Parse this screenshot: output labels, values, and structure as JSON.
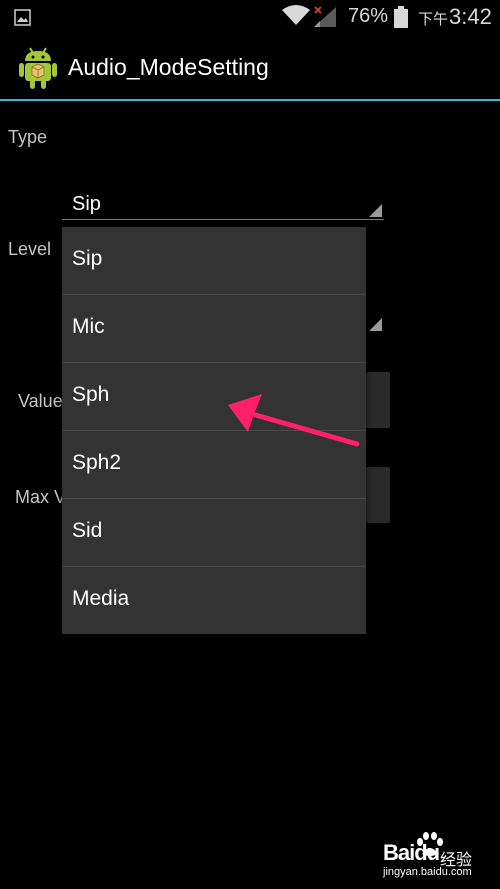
{
  "status_bar": {
    "battery_percent": "76%",
    "ampm": "下午",
    "time": "3:42"
  },
  "action_bar": {
    "title": "Audio_ModeSetting"
  },
  "form": {
    "type_label": "Type",
    "type_value": "Sip",
    "level_label": "Level",
    "value_label": "Value",
    "max_label": "Max V"
  },
  "dropdown": {
    "items": [
      "Sip",
      "Mic",
      "Sph",
      "Sph2",
      "Sid",
      "Media"
    ]
  },
  "watermark": {
    "brand": "Baidu",
    "cn": "经验",
    "url": "jingyan.baidu.com"
  },
  "colors": {
    "accent": "#33b5e5",
    "annotation_arrow": "#ff1f6a",
    "android_green": "#a4c639"
  }
}
